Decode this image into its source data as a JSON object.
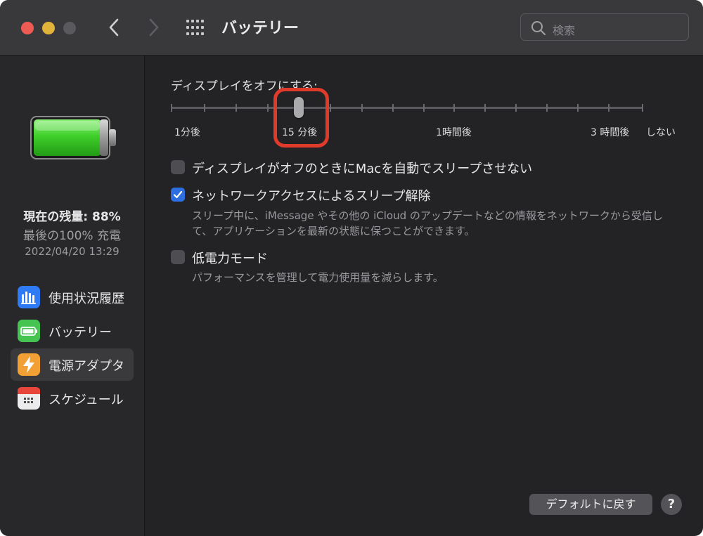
{
  "window": {
    "title": "バッテリー"
  },
  "search": {
    "placeholder": "検索"
  },
  "sidebar": {
    "remaining": "現在の残量: 88%",
    "last_full": "最後の100% 充電",
    "last_full_date": "2022/04/20 13:29",
    "items": [
      {
        "label": "使用状況履歴",
        "icon": "bar-chart-icon",
        "color": "#2f7bf5"
      },
      {
        "label": "バッテリー",
        "icon": "battery-icon",
        "color": "#45c452"
      },
      {
        "label": "電源アダプタ",
        "icon": "lightning-icon",
        "color": "#f2a033",
        "selected": true
      },
      {
        "label": "スケジュール",
        "icon": "calendar-icon",
        "color": "#e6e6e6"
      }
    ]
  },
  "main": {
    "slider": {
      "title": "ディスプレイをオフにする:",
      "labels": [
        "1分後",
        "15 分後",
        "1時間後",
        "3 時間後",
        "しない"
      ],
      "value": "15 分後"
    },
    "options": [
      {
        "label": "ディスプレイがオフのときにMacを自動でスリープさせない",
        "checked": false
      },
      {
        "label": "ネットワークアクセスによるスリープ解除",
        "checked": true,
        "desc_line1": "スリープ中に、iMessage やその他の iCloud のアップデートなどの情報をネットワークから受信し",
        "desc_line2": "て、アプリケーションを最新の状態に保つことができます。"
      },
      {
        "label": "低電力モード",
        "checked": false,
        "desc_line1": "パフォーマンスを管理して電力使用量を減らします。"
      }
    ],
    "default_button": "デフォルトに戻す",
    "help_button": "?"
  },
  "colors": {
    "highlight": "#e03a2b",
    "accent": "#2d6fe0"
  }
}
